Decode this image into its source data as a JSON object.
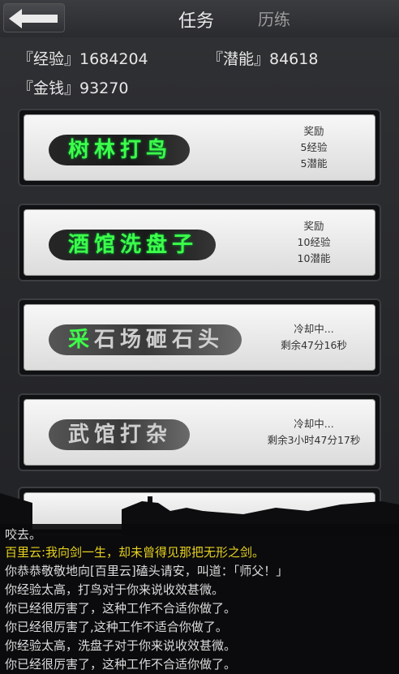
{
  "header": {
    "tab_task": "任务",
    "tab_train": "历练"
  },
  "stats": {
    "exp": "『经验』1684204",
    "potential": "『潜能』84618",
    "money": "『金钱』93270"
  },
  "tasks": [
    {
      "name": "树林打鸟",
      "info": [
        "奖励",
        "5经验",
        "5潜能"
      ],
      "state": "available"
    },
    {
      "name": "酒馆洗盘子",
      "info": [
        "奖励",
        "10经验",
        "10潜能"
      ],
      "state": "available"
    },
    {
      "name_first": "采",
      "name_rest": "石场砸石头",
      "info": [
        "冷却中...",
        "剩余47分16秒"
      ],
      "state": "cooldown"
    },
    {
      "name": "武馆打杂",
      "info": [
        "冷却中...",
        "剩余3小时47分17秒"
      ],
      "state": "cooldown"
    }
  ],
  "log": [
    {
      "text": "咬去。",
      "color": "white"
    },
    {
      "text": "百里云:我向剑一生，却未曾得见那把无形之剑。",
      "color": "yellow"
    },
    {
      "text": "你恭恭敬敬地向[百里云]磕头请安，叫道：「师父！」",
      "color": "white"
    },
    {
      "text": "你经验太高，打鸟对于你来说收效甚微。",
      "color": "white"
    },
    {
      "text": "你已经很厉害了，这种工作不合适你做了。",
      "color": "white"
    },
    {
      "text": "你已经很厉害了,这种工作不适合你做了。",
      "color": "white"
    },
    {
      "text": "你经验太高，洗盘子对于你来说收效甚微。",
      "color": "white"
    },
    {
      "text": "你已经很厉害了，这种工作不合适你做了。",
      "color": "white"
    }
  ],
  "colors": {
    "active_text": "#3dff4a",
    "log_yellow": "#e6d11f"
  }
}
